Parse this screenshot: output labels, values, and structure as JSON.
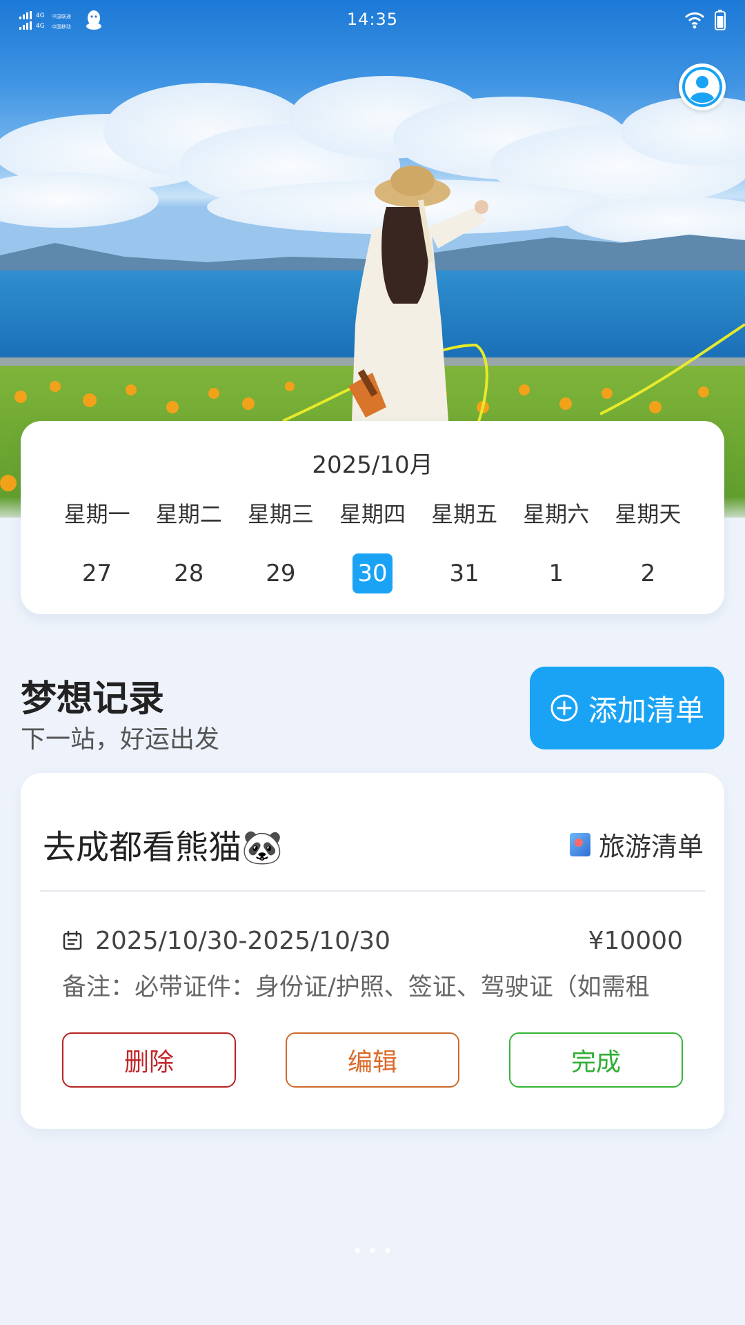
{
  "status_bar": {
    "network_1": "4G",
    "network_2": "4G",
    "carrier_1": "中国联通",
    "carrier_2": "中国移动",
    "time": "14:35",
    "icons": [
      "signal-icon",
      "qq-icon",
      "wifi-icon",
      "battery-icon"
    ]
  },
  "header": {
    "avatar_icon": "user-icon"
  },
  "calendar": {
    "month_label": "2025/10月",
    "weekdays": [
      "星期一",
      "星期二",
      "星期三",
      "星期四",
      "星期五",
      "星期六",
      "星期天"
    ],
    "dates": [
      "27",
      "28",
      "29",
      "30",
      "31",
      "1",
      "2"
    ],
    "selected_date": "30",
    "accent_color": "#1aa3f5"
  },
  "section": {
    "title": "梦想记录",
    "subtitle": "下一站，好运出发",
    "add_button_label": "添加清单",
    "add_button_icon": "plus-circle-icon"
  },
  "items": [
    {
      "title": "去成都看熊猫🐼",
      "category": "旅游清单",
      "category_icon": "book-icon",
      "date_icon": "calendar-icon",
      "date_range": "2025/10/30-2025/10/30",
      "price": "¥10000",
      "note": "备注：必带证件：身份证/护照、签证、驾驶证（如需租",
      "actions": {
        "delete": "删除",
        "edit": "编辑",
        "complete": "完成"
      }
    }
  ],
  "colors": {
    "delete": "#c0262a",
    "edit": "#db6a2a",
    "complete": "#2fae32",
    "background": "#eef3fb"
  }
}
